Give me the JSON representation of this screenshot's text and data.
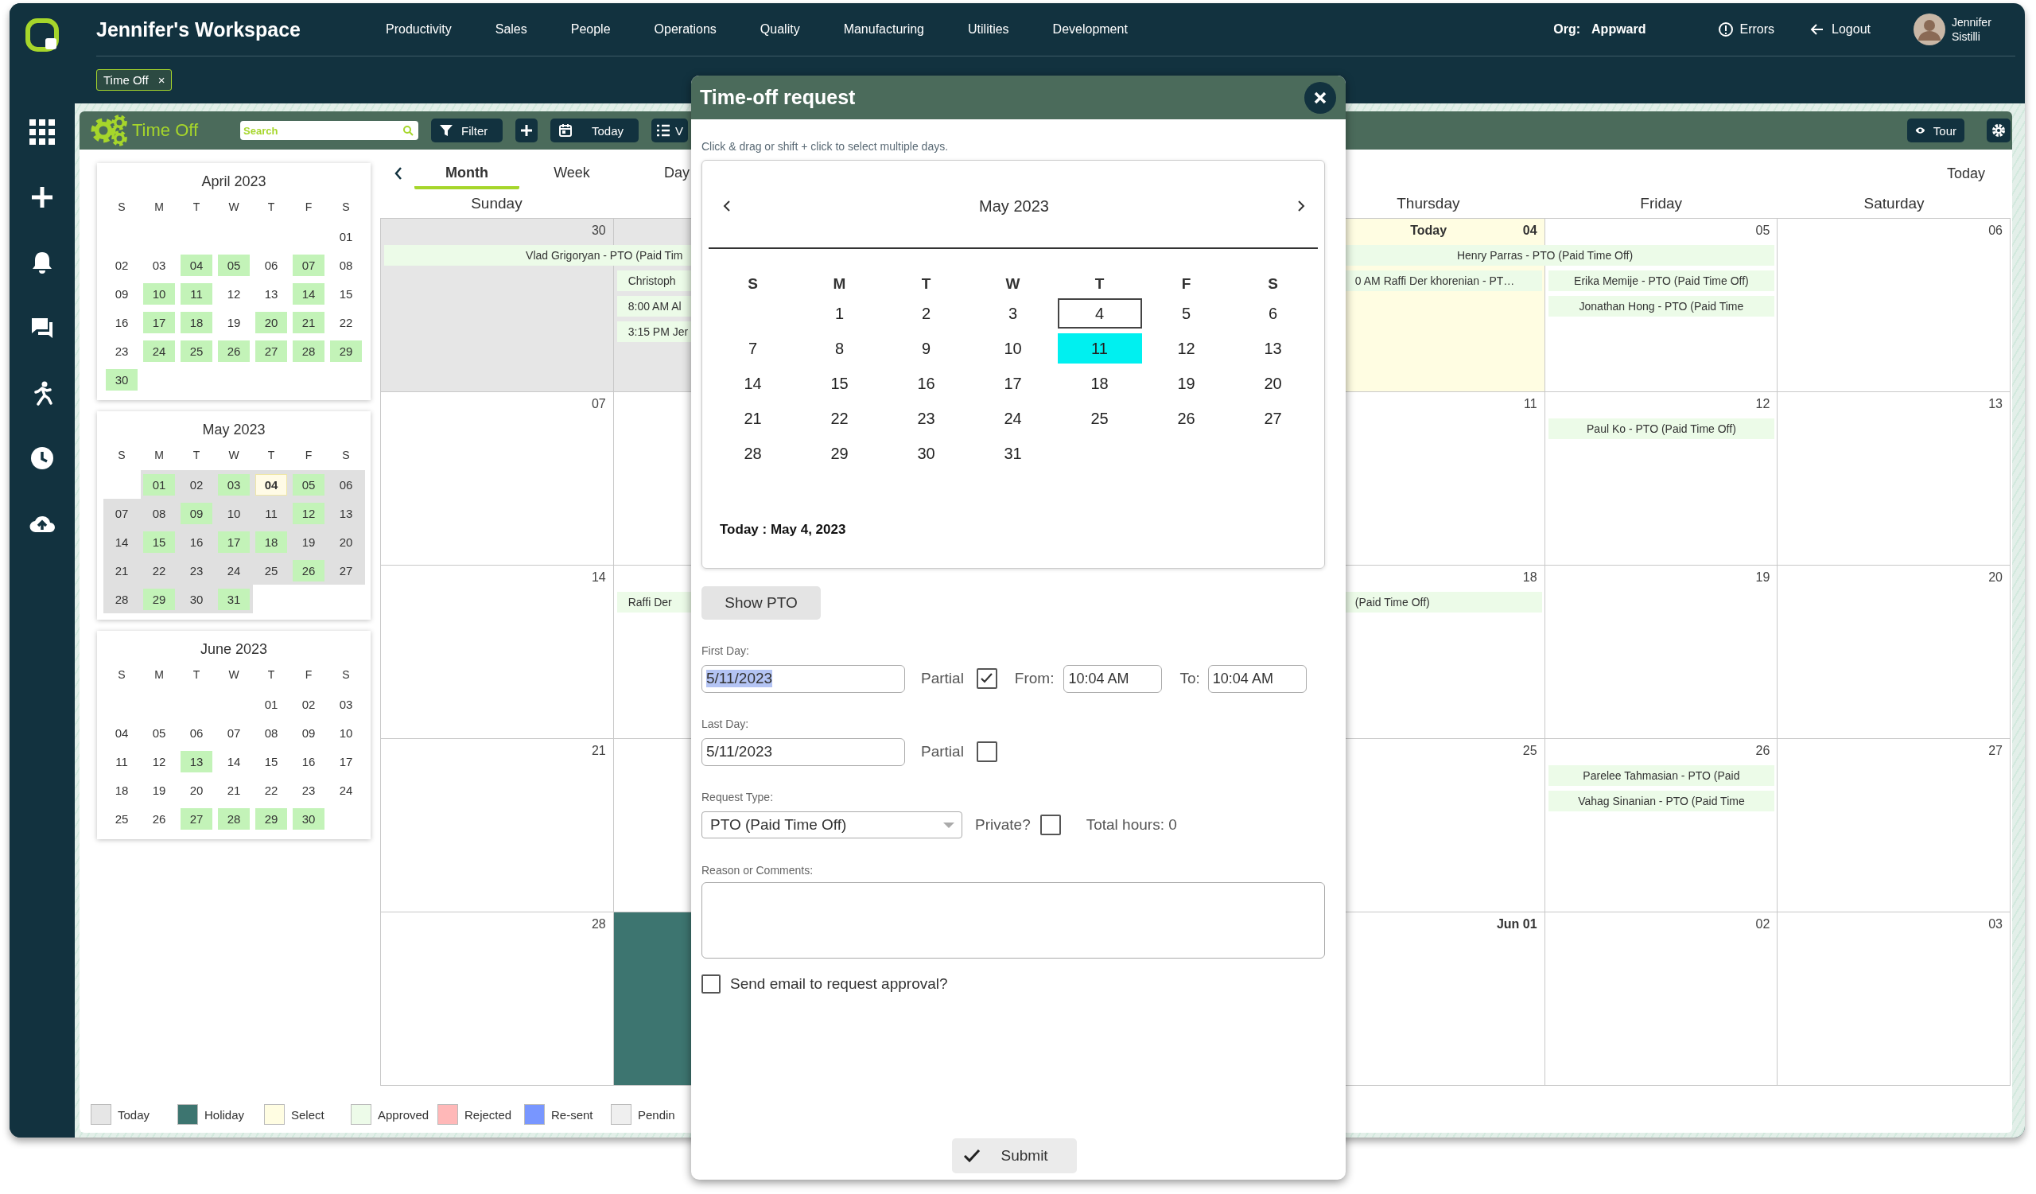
{
  "app": {
    "title": "Jennifer's Workspace"
  },
  "sidebar": {
    "items": [
      {
        "kind": "apps"
      },
      {
        "kind": "add"
      },
      {
        "kind": "notifications"
      },
      {
        "kind": "messages"
      },
      {
        "kind": "activity"
      },
      {
        "kind": "history"
      },
      {
        "kind": "upload"
      }
    ]
  },
  "nav_menu": [
    "Productivity",
    "Sales",
    "People",
    "Operations",
    "Quality",
    "Manufacturing",
    "Utilities",
    "Development"
  ],
  "org": {
    "label": "Org:",
    "value": "Appward"
  },
  "header_actions": [
    {
      "kind": "errors",
      "label": "Errors"
    },
    {
      "kind": "logout",
      "label": "Logout"
    }
  ],
  "user": {
    "name": "Jennifer Sistilli"
  },
  "open_tabs": [
    {
      "label": "Time Off",
      "close": "×"
    }
  ],
  "toolbar": {
    "title": "Time Off",
    "search": {
      "placeholder": "Search"
    },
    "buttons": [
      {
        "kind": "filter",
        "label": "Filter"
      },
      {
        "kind": "add"
      },
      {
        "kind": "today",
        "label": "Today"
      },
      {
        "kind": "list",
        "label": "V"
      }
    ],
    "right_buttons": [
      {
        "kind": "tour",
        "label": "Tour"
      },
      {
        "kind": "settings"
      }
    ]
  },
  "mini_calendars": [
    {
      "title": "April 2023",
      "in_view": false,
      "weekdays": [
        "S",
        "M",
        "T",
        "W",
        "T",
        "F",
        "S"
      ],
      "weeks": [
        [
          {
            "day": "01",
            "approved": false,
            "today": false
          }
        ],
        [
          {
            "day": "02",
            "approved": false,
            "today": false
          },
          {
            "day": "03",
            "approved": false,
            "today": false
          },
          {
            "day": "04",
            "approved": true,
            "today": false
          },
          {
            "day": "05",
            "approved": true,
            "today": false
          },
          {
            "day": "06",
            "approved": false,
            "today": false
          },
          {
            "day": "07",
            "approved": true,
            "today": false
          },
          {
            "day": "08",
            "approved": false,
            "today": false
          }
        ],
        [
          {
            "day": "09",
            "approved": false,
            "today": false
          },
          {
            "day": "10",
            "approved": true,
            "today": false
          },
          {
            "day": "11",
            "approved": true,
            "today": false
          },
          {
            "day": "12",
            "approved": false,
            "today": false
          },
          {
            "day": "13",
            "approved": false,
            "today": false
          },
          {
            "day": "14",
            "approved": true,
            "today": false
          },
          {
            "day": "15",
            "approved": false,
            "today": false
          }
        ],
        [
          {
            "day": "16",
            "approved": false,
            "today": false
          },
          {
            "day": "17",
            "approved": true,
            "today": false
          },
          {
            "day": "18",
            "approved": true,
            "today": false
          },
          {
            "day": "19",
            "approved": false,
            "today": false
          },
          {
            "day": "20",
            "approved": true,
            "today": false
          },
          {
            "day": "21",
            "approved": true,
            "today": false
          },
          {
            "day": "22",
            "approved": false,
            "today": false
          }
        ],
        [
          {
            "day": "23",
            "approved": false,
            "today": false
          },
          {
            "day": "24",
            "approved": true,
            "today": false
          },
          {
            "day": "25",
            "approved": true,
            "today": false
          },
          {
            "day": "26",
            "approved": true,
            "today": false
          },
          {
            "day": "27",
            "approved": true,
            "today": false
          },
          {
            "day": "28",
            "approved": true,
            "today": false
          },
          {
            "day": "29",
            "approved": true,
            "today": false
          }
        ],
        [
          {
            "day": "30",
            "approved": true,
            "today": false
          }
        ]
      ]
    },
    {
      "title": "May 2023",
      "in_view": true,
      "weekdays": [
        "S",
        "M",
        "T",
        "W",
        "T",
        "F",
        "S"
      ],
      "weeks": [
        [
          {
            "day": "01",
            "approved": true,
            "today": false
          },
          {
            "day": "02",
            "approved": false,
            "today": false
          },
          {
            "day": "03",
            "approved": true,
            "today": false
          },
          {
            "day": "04",
            "approved": false,
            "today": true
          },
          {
            "day": "05",
            "approved": true,
            "today": false
          },
          {
            "day": "06",
            "approved": false,
            "today": false
          }
        ],
        [
          {
            "day": "07",
            "approved": false,
            "today": false
          },
          {
            "day": "08",
            "approved": false,
            "today": false
          },
          {
            "day": "09",
            "approved": true,
            "today": false
          },
          {
            "day": "10",
            "approved": false,
            "today": false
          },
          {
            "day": "11",
            "approved": false,
            "today": false
          },
          {
            "day": "12",
            "approved": true,
            "today": false
          },
          {
            "day": "13",
            "approved": false,
            "today": false
          }
        ],
        [
          {
            "day": "14",
            "approved": false,
            "today": false
          },
          {
            "day": "15",
            "approved": true,
            "today": false
          },
          {
            "day": "16",
            "approved": false,
            "today": false
          },
          {
            "day": "17",
            "approved": true,
            "today": false
          },
          {
            "day": "18",
            "approved": true,
            "today": false
          },
          {
            "day": "19",
            "approved": false,
            "today": false
          },
          {
            "day": "20",
            "approved": false,
            "today": false
          }
        ],
        [
          {
            "day": "21",
            "approved": false,
            "today": false
          },
          {
            "day": "22",
            "approved": false,
            "today": false
          },
          {
            "day": "23",
            "approved": false,
            "today": false
          },
          {
            "day": "24",
            "approved": false,
            "today": false
          },
          {
            "day": "25",
            "approved": false,
            "today": false
          },
          {
            "day": "26",
            "approved": true,
            "today": false
          },
          {
            "day": "27",
            "approved": false,
            "today": false
          }
        ],
        [
          {
            "day": "28",
            "approved": false,
            "today": false
          },
          {
            "day": "29",
            "approved": true,
            "today": false
          },
          {
            "day": "30",
            "approved": false,
            "today": false
          },
          {
            "day": "31",
            "approved": true,
            "today": false
          }
        ]
      ]
    },
    {
      "title": "June 2023",
      "in_view": false,
      "weekdays": [
        "S",
        "M",
        "T",
        "W",
        "T",
        "F",
        "S"
      ],
      "weeks": [
        [
          {
            "day": "01",
            "approved": false,
            "today": false
          },
          {
            "day": "02",
            "approved": false,
            "today": false
          },
          {
            "day": "03",
            "approved": false,
            "today": false
          }
        ],
        [
          {
            "day": "04",
            "approved": false,
            "today": false
          },
          {
            "day": "05",
            "approved": false,
            "today": false
          },
          {
            "day": "06",
            "approved": false,
            "today": false
          },
          {
            "day": "07",
            "approved": false,
            "today": false
          },
          {
            "day": "08",
            "approved": false,
            "today": false
          },
          {
            "day": "09",
            "approved": false,
            "today": false
          },
          {
            "day": "10",
            "approved": false,
            "today": false
          }
        ],
        [
          {
            "day": "11",
            "approved": false,
            "today": false
          },
          {
            "day": "12",
            "approved": false,
            "today": false
          },
          {
            "day": "13",
            "approved": true,
            "today": false
          },
          {
            "day": "14",
            "approved": false,
            "today": false
          },
          {
            "day": "15",
            "approved": false,
            "today": false
          },
          {
            "day": "16",
            "approved": false,
            "today": false
          },
          {
            "day": "17",
            "approved": false,
            "today": false
          }
        ],
        [
          {
            "day": "18",
            "approved": false,
            "today": false
          },
          {
            "day": "19",
            "approved": false,
            "today": false
          },
          {
            "day": "20",
            "approved": false,
            "today": false
          },
          {
            "day": "21",
            "approved": false,
            "today": false
          },
          {
            "day": "22",
            "approved": false,
            "today": false
          },
          {
            "day": "23",
            "approved": false,
            "today": false
          },
          {
            "day": "24",
            "approved": false,
            "today": false
          }
        ],
        [
          {
            "day": "25",
            "approved": false,
            "today": false
          },
          {
            "day": "26",
            "approved": false,
            "today": false
          },
          {
            "day": "27",
            "approved": true,
            "today": false
          },
          {
            "day": "28",
            "approved": true,
            "today": false
          },
          {
            "day": "29",
            "approved": true,
            "today": false
          },
          {
            "day": "30",
            "approved": true,
            "today": false
          }
        ]
      ]
    }
  ],
  "calendar": {
    "view_tabs": [
      {
        "label": "Month",
        "selected": true
      },
      {
        "label": "Week",
        "selected": false
      },
      {
        "label": "Day",
        "selected": false
      }
    ],
    "today_link": "Today",
    "left_headers": [
      "Sunday"
    ],
    "right_headers": [
      "Thursday",
      "Friday",
      "Saturday"
    ],
    "weeks": [
      {
        "left": [
          {
            "number": "30",
            "kind": "today",
            "events": [
              {
                "text": "Vlad Grigoryan - PTO (Paid Tim",
                "spans_next_day": true
              }
            ]
          },
          {
            "kind": "today",
            "events": [
              {
                "text": "Christoph",
                "spans_next_day": false
              },
              {
                "text": "8:00 AM Al",
                "spans_next_day": false
              },
              {
                "text": "3:15 PM Jer",
                "spans_next_day": false
              }
            ]
          }
        ],
        "right": [
          {
            "label": "Today",
            "number": "04",
            "bold": true,
            "kind": "select",
            "events": [
              {
                "text": "Henry Parras - PTO (Paid Time Off)",
                "spans_next_day": true
              },
              {
                "text": "0 AM Raffi Der khorenian - PT…",
                "spans_next_day": false
              }
            ]
          },
          {
            "number": "05",
            "bold": false,
            "events": [
              {
                "text": "Erika Memije - PTO (Paid Time Off)",
                "spans_next_day": false
              },
              {
                "text": "Jonathan Hong - PTO (Paid Time",
                "spans_next_day": false
              }
            ]
          },
          {
            "number": "06",
            "bold": false
          }
        ]
      },
      {
        "left": [
          {
            "number": "07",
            "bold": false
          }
        ],
        "right": [
          {
            "number": "11",
            "bold": false
          },
          {
            "number": "12",
            "bold": false,
            "events": [
              {
                "text": "Paul Ko - PTO (Paid Time Off)",
                "spans_next_day": false
              }
            ]
          },
          {
            "number": "13",
            "bold": false
          }
        ]
      },
      {
        "left": [
          {
            "number": "14",
            "bold": false
          },
          {
            "events": [
              {
                "text": "Raffi Der",
                "spans_next_day": false
              }
            ]
          }
        ],
        "right": [
          {
            "number": "18",
            "bold": false,
            "events": [
              {
                "text": "(Paid Time Off)",
                "spans_next_day": false
              }
            ]
          },
          {
            "number": "19",
            "bold": false
          },
          {
            "number": "20",
            "bold": false
          }
        ]
      },
      {
        "left": [
          {
            "number": "21",
            "bold": false
          }
        ],
        "right": [
          {
            "number": "25",
            "bold": false
          },
          {
            "number": "26",
            "bold": false,
            "events": [
              {
                "text": "Parelee Tahmasian - PTO (Paid",
                "spans_next_day": false
              },
              {
                "text": "Vahag Sinanian - PTO (Paid Time",
                "spans_next_day": false
              }
            ]
          },
          {
            "number": "27",
            "bold": false
          }
        ]
      },
      {
        "left": [
          {
            "number": "28",
            "bold": false
          },
          {
            "kind": "holiday"
          }
        ],
        "right": [
          {
            "number": "Jun 01",
            "bold": true
          },
          {
            "number": "02",
            "bold": false
          },
          {
            "number": "03",
            "bold": false
          }
        ]
      }
    ]
  },
  "legend": [
    {
      "kind": "today",
      "label": "Today",
      "color": "#e6e6e6"
    },
    {
      "kind": "holiday",
      "label": "Holiday",
      "color": "#3d7570"
    },
    {
      "kind": "select",
      "label": "Select",
      "color": "#fffde2"
    },
    {
      "kind": "approved",
      "label": "Approved",
      "color": "#edfbe9"
    },
    {
      "kind": "rejected",
      "label": "Rejected",
      "color": "#ffb8b8"
    },
    {
      "kind": "resent",
      "label": "Re-sent",
      "color": "#7896ff"
    },
    {
      "kind": "pending",
      "label": "Pendin",
      "color": "#efefef"
    }
  ],
  "dialog": {
    "title": "Time-off request",
    "hint": "Click & drag or shift + click to select multiple days.",
    "calendar": {
      "month": "May 2023",
      "weekdays": [
        "S",
        "M",
        "T",
        "W",
        "T",
        "F",
        "S"
      ],
      "weeks": [
        [
          {
            "day": "1",
            "today": false,
            "selected": false
          },
          {
            "day": "2",
            "today": false,
            "selected": false
          },
          {
            "day": "3",
            "today": false,
            "selected": false
          },
          {
            "day": "4",
            "today": true,
            "selected": false
          },
          {
            "day": "5",
            "today": false,
            "selected": false
          },
          {
            "day": "6",
            "today": false,
            "selected": false
          }
        ],
        [
          {
            "day": "7",
            "today": false,
            "selected": false
          },
          {
            "day": "8",
            "today": false,
            "selected": false
          },
          {
            "day": "9",
            "today": false,
            "selected": false
          },
          {
            "day": "10",
            "today": false,
            "selected": false
          },
          {
            "day": "11",
            "today": false,
            "selected": true
          },
          {
            "day": "12",
            "today": false,
            "selected": false
          },
          {
            "day": "13",
            "today": false,
            "selected": false
          }
        ],
        [
          {
            "day": "14",
            "today": false,
            "selected": false
          },
          {
            "day": "15",
            "today": false,
            "selected": false
          },
          {
            "day": "16",
            "today": false,
            "selected": false
          },
          {
            "day": "17",
            "today": false,
            "selected": false
          },
          {
            "day": "18",
            "today": false,
            "selected": false
          },
          {
            "day": "19",
            "today": false,
            "selected": false
          },
          {
            "day": "20",
            "today": false,
            "selected": false
          }
        ],
        [
          {
            "day": "21",
            "today": false,
            "selected": false
          },
          {
            "day": "22",
            "today": false,
            "selected": false
          },
          {
            "day": "23",
            "today": false,
            "selected": false
          },
          {
            "day": "24",
            "today": false,
            "selected": false
          },
          {
            "day": "25",
            "today": false,
            "selected": false
          },
          {
            "day": "26",
            "today": false,
            "selected": false
          },
          {
            "day": "27",
            "today": false,
            "selected": false
          }
        ],
        [
          {
            "day": "28",
            "today": false,
            "selected": false
          },
          {
            "day": "29",
            "today": false,
            "selected": false
          },
          {
            "day": "30",
            "today": false,
            "selected": false
          },
          {
            "day": "31",
            "today": false,
            "selected": false
          }
        ]
      ],
      "today_text": "Today : May 4, 2023"
    },
    "show_pto_button": "Show PTO",
    "first_day": {
      "label": "First Day:",
      "value": "5/11/2023",
      "value_selected": true,
      "partial": {
        "label": "Partial",
        "checked": true
      },
      "from": {
        "label": "From:",
        "value": "10:04 AM"
      },
      "to": {
        "label": "To:",
        "value": "10:04 AM"
      }
    },
    "last_day": {
      "label": "Last Day:",
      "value": "5/11/2023",
      "value_selected": false,
      "partial": {
        "label": "Partial",
        "checked": false
      }
    },
    "request_type": {
      "label": "Request Type:",
      "value": "PTO (Paid Time Off)"
    },
    "private": {
      "label": "Private?",
      "checked": false
    },
    "total_hours": "Total hours: 0",
    "comments": {
      "label": "Reason or Comments:"
    },
    "send_email": {
      "label": "Send email to request approval?",
      "checked": false
    },
    "submit": "Submit"
  }
}
